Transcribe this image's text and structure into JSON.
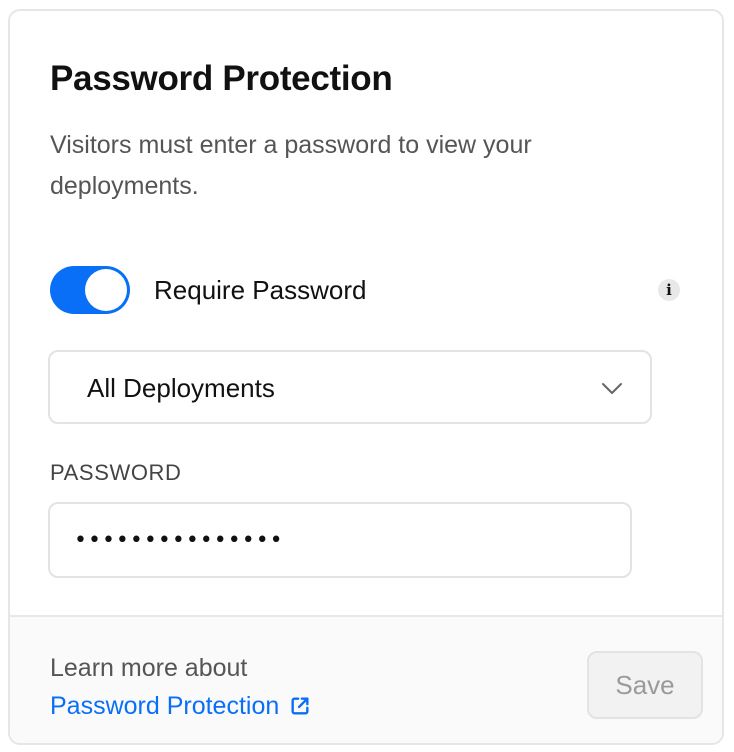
{
  "card": {
    "title": "Password Protection",
    "description": "Visitors must enter a password to view your deployments."
  },
  "toggle": {
    "label": "Require Password",
    "checked": true,
    "accent_color": "#0a6ff7"
  },
  "info_icon": "info-icon",
  "select": {
    "value": "All Deployments",
    "icon": "chevron-down-icon"
  },
  "password": {
    "label": "PASSWORD",
    "value": "•••••••••••••••",
    "placeholder": ""
  },
  "footer": {
    "learn_text": "Learn more about",
    "link_label": "Password Protection",
    "link_icon": "external-link-icon",
    "save_label": "Save",
    "save_disabled": true
  }
}
